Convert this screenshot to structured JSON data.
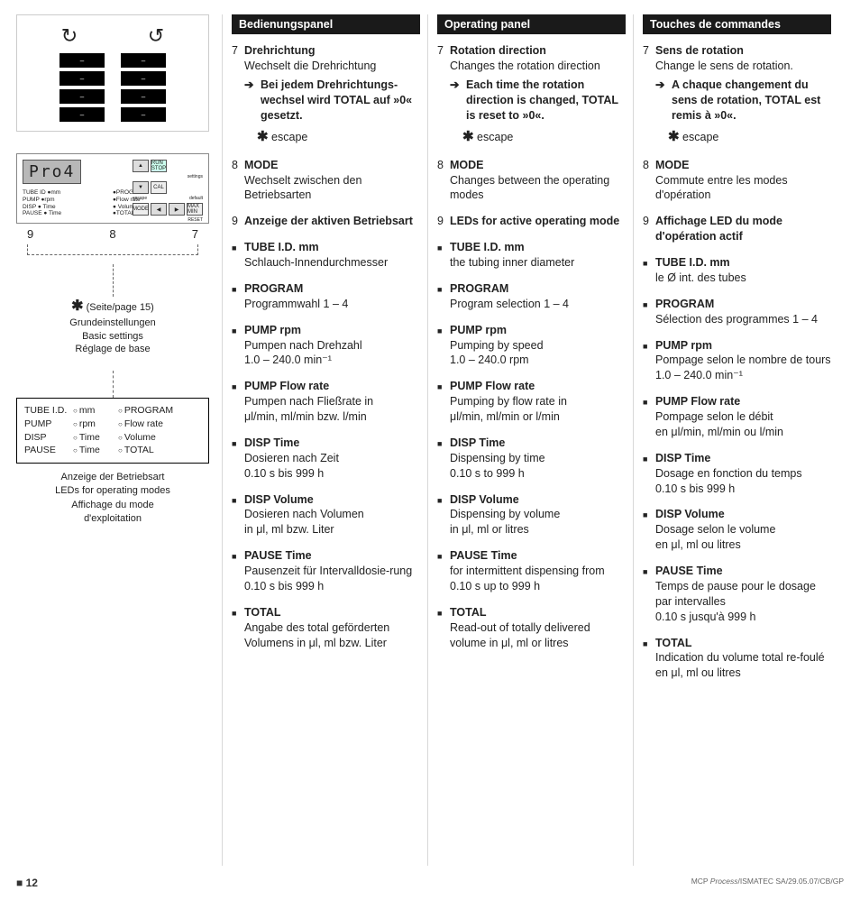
{
  "page_number": "12",
  "imprint": "MCP Process/ISMATEC SA/29.05.07/CB/GP",
  "left": {
    "display": "Pro4",
    "panel_labels_left": [
      "TUBE ID ●mm",
      "PUMP ●rpm",
      "DISP ● Time",
      "PAUSE ● Time"
    ],
    "panel_labels_right": [
      "●PROGRAM",
      "●Flow rate",
      "● Volume",
      "●TOTAL"
    ],
    "btn_run": "RUN STOP",
    "btn_cal": "CAL",
    "btn_mode": "MODE",
    "btn_maxmin": "MAX MIN",
    "btn_reset": "RESET",
    "btn_settings": "settings",
    "btn_default": "default",
    "callout_9": "9",
    "callout_8": "8",
    "callout_7": "7",
    "settings_ref": "(Seite/page 15)",
    "settings_de": "Grundeinstellungen",
    "settings_en": "Basic settings",
    "settings_fr": "Réglage de base",
    "led_rows": [
      {
        "a": "TUBE I.D.",
        "b": "mm",
        "c": "PROGRAM"
      },
      {
        "a": "PUMP",
        "b": "rpm",
        "c": "Flow rate"
      },
      {
        "a": "DISP",
        "b": "Time",
        "c": "Volume"
      },
      {
        "a": "PAUSE",
        "b": "Time",
        "c": "TOTAL"
      }
    ],
    "led_cap_de": "Anzeige der Betriebsart",
    "led_cap_en": "LEDs for operating modes",
    "led_cap_fr1": "Affichage du mode",
    "led_cap_fr2": "d'exploitation"
  },
  "cols": [
    {
      "header": "Bedienungspanel",
      "item7_n": "7",
      "item7_title": "Drehrichtung",
      "item7_sub": "Wechselt die Drehrichtung",
      "item7_arrow": "Bei jedem Drehrichtungs-wechsel wird TOTAL auf »0« gesetzt.",
      "escape": "escape",
      "item8_n": "8",
      "item8_title": "MODE",
      "item8_sub": "Wechselt zwischen den Betriebsarten",
      "item9_n": "9",
      "item9_title": "Anzeige der aktiven Betriebsart",
      "bullets": [
        {
          "t": "TUBE I.D. mm",
          "d": "Schlauch-Innendurchmesser"
        },
        {
          "t": "PROGRAM",
          "d": "Programmwahl 1 – 4"
        },
        {
          "t": "PUMP rpm",
          "d": "Pumpen nach Drehzahl\n1.0 – 240.0 min⁻¹"
        },
        {
          "t": "PUMP Flow rate",
          "d": "Pumpen nach Fließrate in\nμl/min, ml/min bzw. l/min"
        },
        {
          "t": "DISP Time",
          "d": "Dosieren nach Zeit\n0.10 s bis 999 h"
        },
        {
          "t": "DISP Volume",
          "d": "Dosieren nach Volumen\nin μl, ml bzw. Liter"
        },
        {
          "t": "PAUSE Time",
          "d": "Pausenzeit für Intervalldosie-rung 0.10 s bis 999 h"
        },
        {
          "t": "TOTAL",
          "d": "Angabe des total geförderten Volumens in μl, ml bzw. Liter"
        }
      ]
    },
    {
      "header": "Operating panel",
      "item7_n": "7",
      "item7_title": "Rotation direction",
      "item7_sub": "Changes the rotation direction",
      "item7_arrow": "Each time the rotation direction is changed, TOTAL is reset to »0«.",
      "escape": "escape",
      "item8_n": "8",
      "item8_title": "MODE",
      "item8_sub": "Changes between the operating modes",
      "item9_n": "9",
      "item9_title": "LEDs for active operating mode",
      "bullets": [
        {
          "t": "TUBE I.D. mm",
          "d": "the tubing inner diameter"
        },
        {
          "t": "PROGRAM",
          "d": "Program selection 1 – 4"
        },
        {
          "t": "PUMP rpm",
          "d": "Pumping by speed\n1.0 – 240.0 rpm"
        },
        {
          "t": "PUMP Flow rate",
          "d": "Pumping by flow rate in\nμl/min, ml/min or l/min"
        },
        {
          "t": "DISP Time",
          "d": "Dispensing by time\n0.10 s to 999 h"
        },
        {
          "t": "DISP Volume",
          "d": "Dispensing by volume\nin μl, ml or litres"
        },
        {
          "t": "PAUSE Time",
          "d": "for intermittent dispensing from 0.10 s up to 999 h"
        },
        {
          "t": "TOTAL",
          "d": "Read-out of totally delivered volume in μl, ml or litres"
        }
      ]
    },
    {
      "header": "Touches de commandes",
      "item7_n": "7",
      "item7_title": "Sens de rotation",
      "item7_sub": "Change le sens de rotation.",
      "item7_arrow": "A chaque changement du sens de rotation, TOTAL est remis à »0«.",
      "escape": "escape",
      "item8_n": "8",
      "item8_title": "MODE",
      "item8_sub": "Commute entre les modes d'opération",
      "item9_n": "9",
      "item9_title": "Affichage LED du mode d'opération actif",
      "bullets": [
        {
          "t": "TUBE I.D. mm",
          "d": "le Ø int. des tubes"
        },
        {
          "t": "PROGRAM",
          "d": "Sélection des programmes 1 – 4"
        },
        {
          "t": "PUMP rpm",
          "d": "Pompage selon le nombre de tours 1.0 – 240.0 min⁻¹"
        },
        {
          "t": "PUMP Flow rate",
          "d": "Pompage selon le débit\nen μl/min, ml/min ou l/min"
        },
        {
          "t": "DISP Time",
          "d": "Dosage en fonction du temps\n0.10 s bis 999 h"
        },
        {
          "t": "DISP Volume",
          "d": "Dosage selon le volume\nen μl, ml  ou litres"
        },
        {
          "t": "PAUSE Time",
          "d": "Temps de pause pour le dosage par intervalles\n0.10 s jusqu'à 999 h"
        },
        {
          "t": "TOTAL",
          "d": "Indication du volume total re-foulé en μl, ml ou litres"
        }
      ]
    }
  ]
}
